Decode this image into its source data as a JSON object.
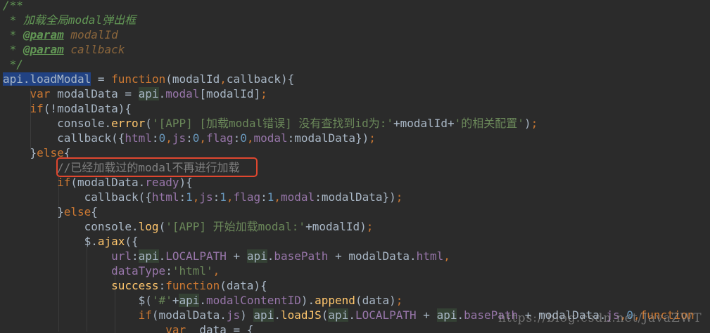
{
  "editor": {
    "lines": [
      [
        {
          "t": "/**",
          "c": "comment"
        }
      ],
      [
        {
          "t": " * 加载全局modal弹出框",
          "c": "comment"
        }
      ],
      [
        {
          "t": " * ",
          "c": "comment"
        },
        {
          "t": "@param",
          "c": "doctag"
        },
        {
          "t": " modalId",
          "c": "docparam"
        }
      ],
      [
        {
          "t": " * ",
          "c": "comment"
        },
        {
          "t": "@param",
          "c": "doctag"
        },
        {
          "t": " callback",
          "c": "docparam"
        }
      ],
      [
        {
          "t": " */",
          "c": "comment"
        }
      ],
      [
        {
          "t": "api.loadModal",
          "c": "decl"
        },
        {
          "t": " = ",
          "c": "punct"
        },
        {
          "t": "function",
          "c": "keyword"
        },
        {
          "t": "(modalId",
          "c": "punct"
        },
        {
          "t": ",",
          "c": "comma"
        },
        {
          "t": "callback){",
          "c": "punct"
        }
      ],
      [
        {
          "t": "    ",
          "c": "punct"
        },
        {
          "t": "var",
          "c": "keyword"
        },
        {
          "t": " modalData = ",
          "c": "ident"
        },
        {
          "t": "api",
          "c": "obj"
        },
        {
          "t": ".",
          "c": "punct"
        },
        {
          "t": "modal",
          "c": "prop"
        },
        {
          "t": "[modalId]",
          "c": "punct"
        },
        {
          "t": ";",
          "c": "comma"
        }
      ],
      [
        {
          "t": "    ",
          "c": "punct"
        },
        {
          "t": "if",
          "c": "keyword"
        },
        {
          "t": "(!modalData){",
          "c": "punct"
        }
      ],
      [
        {
          "t": "        console.",
          "c": "ident"
        },
        {
          "t": "error",
          "c": "method"
        },
        {
          "t": "(",
          "c": "punct"
        },
        {
          "t": "'[APP] [加载modal错误] 没有查找到id为:'",
          "c": "string"
        },
        {
          "t": "+modalId+",
          "c": "punct"
        },
        {
          "t": "'的相关配置'",
          "c": "string"
        },
        {
          "t": ")",
          "c": "punct"
        },
        {
          "t": ";",
          "c": "comma"
        }
      ],
      [
        {
          "t": "        callback({",
          "c": "ident"
        },
        {
          "t": "html",
          "c": "prop"
        },
        {
          "t": ":",
          "c": "punct"
        },
        {
          "t": "0",
          "c": "number"
        },
        {
          "t": ",",
          "c": "comma"
        },
        {
          "t": "js",
          "c": "prop"
        },
        {
          "t": ":",
          "c": "punct"
        },
        {
          "t": "0",
          "c": "number"
        },
        {
          "t": ",",
          "c": "comma"
        },
        {
          "t": "flag",
          "c": "prop"
        },
        {
          "t": ":",
          "c": "punct"
        },
        {
          "t": "0",
          "c": "number"
        },
        {
          "t": ",",
          "c": "comma"
        },
        {
          "t": "modal",
          "c": "prop"
        },
        {
          "t": ":modalData})",
          "c": "punct"
        },
        {
          "t": ";",
          "c": "comma"
        }
      ],
      [
        {
          "t": "    }",
          "c": "punct"
        },
        {
          "t": "else",
          "c": "keyword"
        },
        {
          "t": "{",
          "c": "punct"
        }
      ],
      [
        {
          "t": "        ",
          "c": "punct"
        },
        {
          "t": "//已经加载过的modal不再进行加载",
          "c": "linecomment"
        }
      ],
      [
        {
          "t": "        ",
          "c": "punct"
        },
        {
          "t": "if",
          "c": "keyword"
        },
        {
          "t": "(modalData.",
          "c": "punct"
        },
        {
          "t": "ready",
          "c": "prop"
        },
        {
          "t": "){",
          "c": "punct"
        }
      ],
      [
        {
          "t": "            callback({",
          "c": "ident"
        },
        {
          "t": "html",
          "c": "prop"
        },
        {
          "t": ":",
          "c": "punct"
        },
        {
          "t": "1",
          "c": "number"
        },
        {
          "t": ",",
          "c": "comma"
        },
        {
          "t": "js",
          "c": "prop"
        },
        {
          "t": ":",
          "c": "punct"
        },
        {
          "t": "1",
          "c": "number"
        },
        {
          "t": ",",
          "c": "comma"
        },
        {
          "t": "flag",
          "c": "prop"
        },
        {
          "t": ":",
          "c": "punct"
        },
        {
          "t": "1",
          "c": "number"
        },
        {
          "t": ",",
          "c": "comma"
        },
        {
          "t": "modal",
          "c": "prop"
        },
        {
          "t": ":modalData})",
          "c": "punct"
        },
        {
          "t": ";",
          "c": "comma"
        }
      ],
      [
        {
          "t": "        }",
          "c": "punct"
        },
        {
          "t": "else",
          "c": "keyword"
        },
        {
          "t": "{",
          "c": "punct"
        }
      ],
      [
        {
          "t": "            console.",
          "c": "ident"
        },
        {
          "t": "log",
          "c": "method"
        },
        {
          "t": "(",
          "c": "punct"
        },
        {
          "t": "'[APP] 开始加载modal:'",
          "c": "string"
        },
        {
          "t": "+modalId)",
          "c": "punct"
        },
        {
          "t": ";",
          "c": "comma"
        }
      ],
      [
        {
          "t": "            $.",
          "c": "ident"
        },
        {
          "t": "ajax",
          "c": "method"
        },
        {
          "t": "({",
          "c": "punct"
        }
      ],
      [
        {
          "t": "                ",
          "c": "punct"
        },
        {
          "t": "url",
          "c": "prop"
        },
        {
          "t": ":",
          "c": "punct"
        },
        {
          "t": "api",
          "c": "obj"
        },
        {
          "t": ".",
          "c": "punct"
        },
        {
          "t": "LOCALPATH",
          "c": "prop"
        },
        {
          "t": " + ",
          "c": "punct"
        },
        {
          "t": "api",
          "c": "obj"
        },
        {
          "t": ".",
          "c": "punct"
        },
        {
          "t": "basePath",
          "c": "prop"
        },
        {
          "t": " + modalData.",
          "c": "punct"
        },
        {
          "t": "html",
          "c": "prop"
        },
        {
          "t": ",",
          "c": "comma"
        }
      ],
      [
        {
          "t": "                ",
          "c": "punct"
        },
        {
          "t": "dataType",
          "c": "prop"
        },
        {
          "t": ":",
          "c": "punct"
        },
        {
          "t": "'html'",
          "c": "string"
        },
        {
          "t": ",",
          "c": "comma"
        }
      ],
      [
        {
          "t": "                ",
          "c": "punct"
        },
        {
          "t": "success",
          "c": "method"
        },
        {
          "t": ":",
          "c": "punct"
        },
        {
          "t": "function",
          "c": "keyword"
        },
        {
          "t": "(data){",
          "c": "punct"
        }
      ],
      [
        {
          "t": "                    $(",
          "c": "punct"
        },
        {
          "t": "'#'",
          "c": "string"
        },
        {
          "t": "+",
          "c": "punct"
        },
        {
          "t": "api",
          "c": "obj"
        },
        {
          "t": ".",
          "c": "punct"
        },
        {
          "t": "modalContentID",
          "c": "prop"
        },
        {
          "t": ").",
          "c": "punct"
        },
        {
          "t": "append",
          "c": "method"
        },
        {
          "t": "(data)",
          "c": "punct"
        },
        {
          "t": ";",
          "c": "comma"
        }
      ],
      [
        {
          "t": "                    ",
          "c": "punct"
        },
        {
          "t": "if",
          "c": "keyword"
        },
        {
          "t": "(modalData.",
          "c": "punct"
        },
        {
          "t": "js",
          "c": "prop"
        },
        {
          "t": ") ",
          "c": "punct"
        },
        {
          "t": "api",
          "c": "obj"
        },
        {
          "t": ".",
          "c": "punct"
        },
        {
          "t": "loadJS",
          "c": "method"
        },
        {
          "t": "(",
          "c": "punct"
        },
        {
          "t": "api",
          "c": "obj"
        },
        {
          "t": ".",
          "c": "punct"
        },
        {
          "t": "LOCALPATH",
          "c": "prop"
        },
        {
          "t": " + ",
          "c": "punct"
        },
        {
          "t": "api",
          "c": "obj"
        },
        {
          "t": ".",
          "c": "punct"
        },
        {
          "t": "basePath",
          "c": "prop"
        },
        {
          "t": " + modalData.",
          "c": "punct"
        },
        {
          "t": "js",
          "c": "prop"
        },
        {
          "t": ",",
          "c": "comma"
        },
        {
          "t": "0",
          "c": "number"
        },
        {
          "t": ",",
          "c": "comma"
        },
        {
          "t": "function",
          "c": "keyword"
        }
      ],
      [
        {
          "t": "                        ",
          "c": "punct"
        },
        {
          "t": "var",
          "c": "keyword"
        },
        {
          "t": "  data = {",
          "c": "ident"
        }
      ]
    ]
  },
  "watermark": {
    "text": "https://blog.csdn.net/JavaZWT"
  },
  "colors": {
    "background": "#2b2b2b",
    "keyword": "#cc7832",
    "string": "#6a8759",
    "number": "#6897bb",
    "property": "#9876aa",
    "method": "#ffc66d",
    "comment": "#629755",
    "line_comment": "#808080",
    "highlight_box": "#e0472f"
  }
}
